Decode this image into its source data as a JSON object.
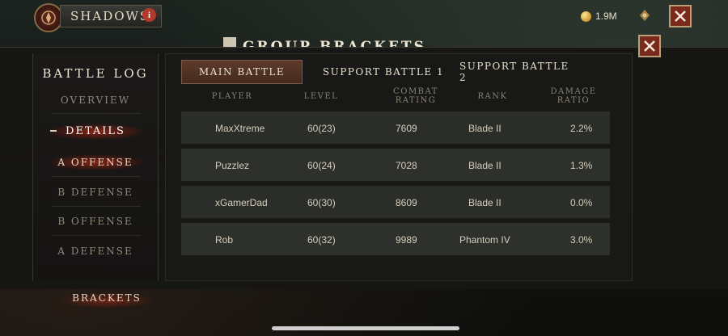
{
  "header": {
    "clan_name": "SHADOWS",
    "info_glyph": "i",
    "gold_amount": "1.9M",
    "background_title": "GROUP BRACKETS",
    "icons": [
      "clan-emblem-icon",
      "info-icon",
      "gold-coin-icon",
      "rune-icon",
      "close-icon"
    ]
  },
  "sidebar": {
    "title": "BATTLE LOG",
    "items": [
      {
        "label": "OVERVIEW",
        "state": "normal"
      },
      {
        "label": "DETAILS",
        "state": "active"
      },
      {
        "label": "A OFFENSE",
        "state": "selected"
      },
      {
        "label": "B DEFENSE",
        "state": "normal"
      },
      {
        "label": "B OFFENSE",
        "state": "normal"
      },
      {
        "label": "A DEFENSE",
        "state": "normal"
      }
    ],
    "brackets_label": "BRACKETS"
  },
  "tabs": [
    {
      "label": "MAIN BATTLE",
      "active": true
    },
    {
      "label": "SUPPORT BATTLE 1",
      "active": false
    },
    {
      "label": "SUPPORT BATTLE 2",
      "active": false
    }
  ],
  "table": {
    "headers": {
      "player": "PLAYER",
      "level": "LEVEL",
      "combat_line1": "COMBAT",
      "combat_line2": "RATING",
      "rank": "RANK",
      "damage_line1": "DAMAGE",
      "damage_line2": "RATIO"
    },
    "rows": [
      {
        "player": "MaxXtreme",
        "level": "60(23)",
        "combat_rating": "7609",
        "rank": "Blade II",
        "damage_ratio": "2.2%"
      },
      {
        "player": "Puzzlez",
        "level": "60(24)",
        "combat_rating": "7028",
        "rank": "Blade II",
        "damage_ratio": "1.3%"
      },
      {
        "player": "xGamerDad",
        "level": "60(30)",
        "combat_rating": "8609",
        "rank": "Blade II",
        "damage_ratio": "0.0%"
      },
      {
        "player": "Rob",
        "level": "60(32)",
        "combat_rating": "9989",
        "rank": "Phantom IV",
        "damage_ratio": "3.0%"
      }
    ]
  },
  "colors": {
    "accent_red": "#b33a2a",
    "active_tab": "#5d3b2b",
    "gold": "#c9982e"
  }
}
